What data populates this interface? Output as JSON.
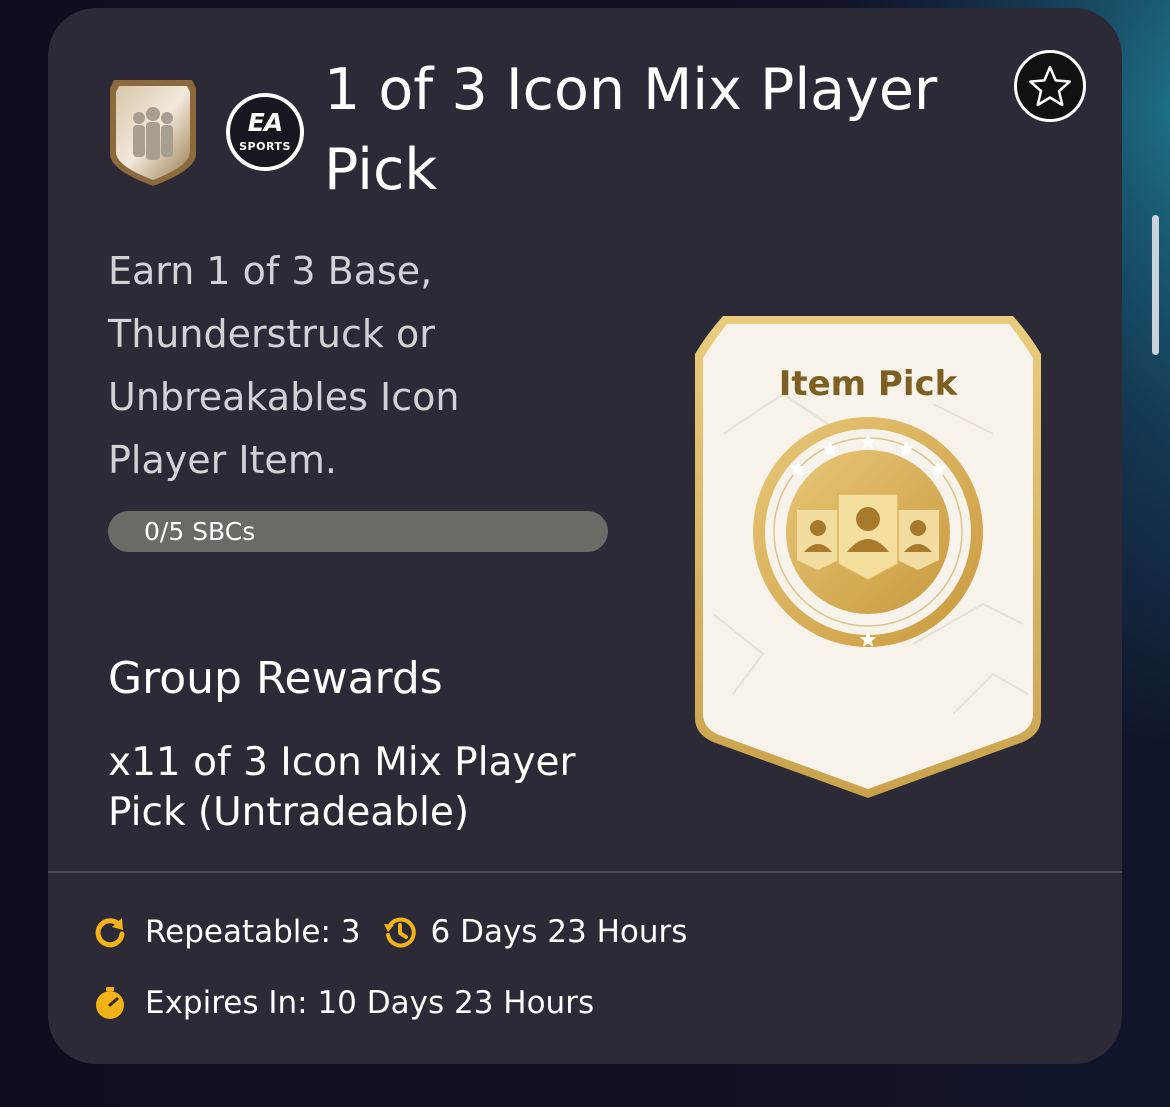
{
  "sbc": {
    "title": "1 of 3 Icon Mix Player Pick",
    "description": "Earn 1 of 3 Base, Thunderstruck or Unbreakables Icon Player Item.",
    "progress": {
      "label": "0/5 SBCs",
      "completed": 0,
      "total": 5
    },
    "favorite_icon": "star-outline-icon",
    "brand_logo_text": {
      "main": "EA",
      "sub": "SPORTS"
    },
    "reward_card": {
      "title": "Item Pick",
      "stars": 6
    },
    "group_rewards": {
      "heading": "Group Rewards",
      "item": "x11 of 3 Icon Mix Player Pick (Untradeable)"
    },
    "footer": {
      "repeatable": "Repeatable: 3",
      "refresh": "6 Days 23 Hours",
      "expires": "Expires In: 10 Days 23 Hours"
    }
  },
  "colors": {
    "card_bg": "#2b2a36",
    "accent": "#f2b318",
    "gold": "#c9a24f"
  }
}
